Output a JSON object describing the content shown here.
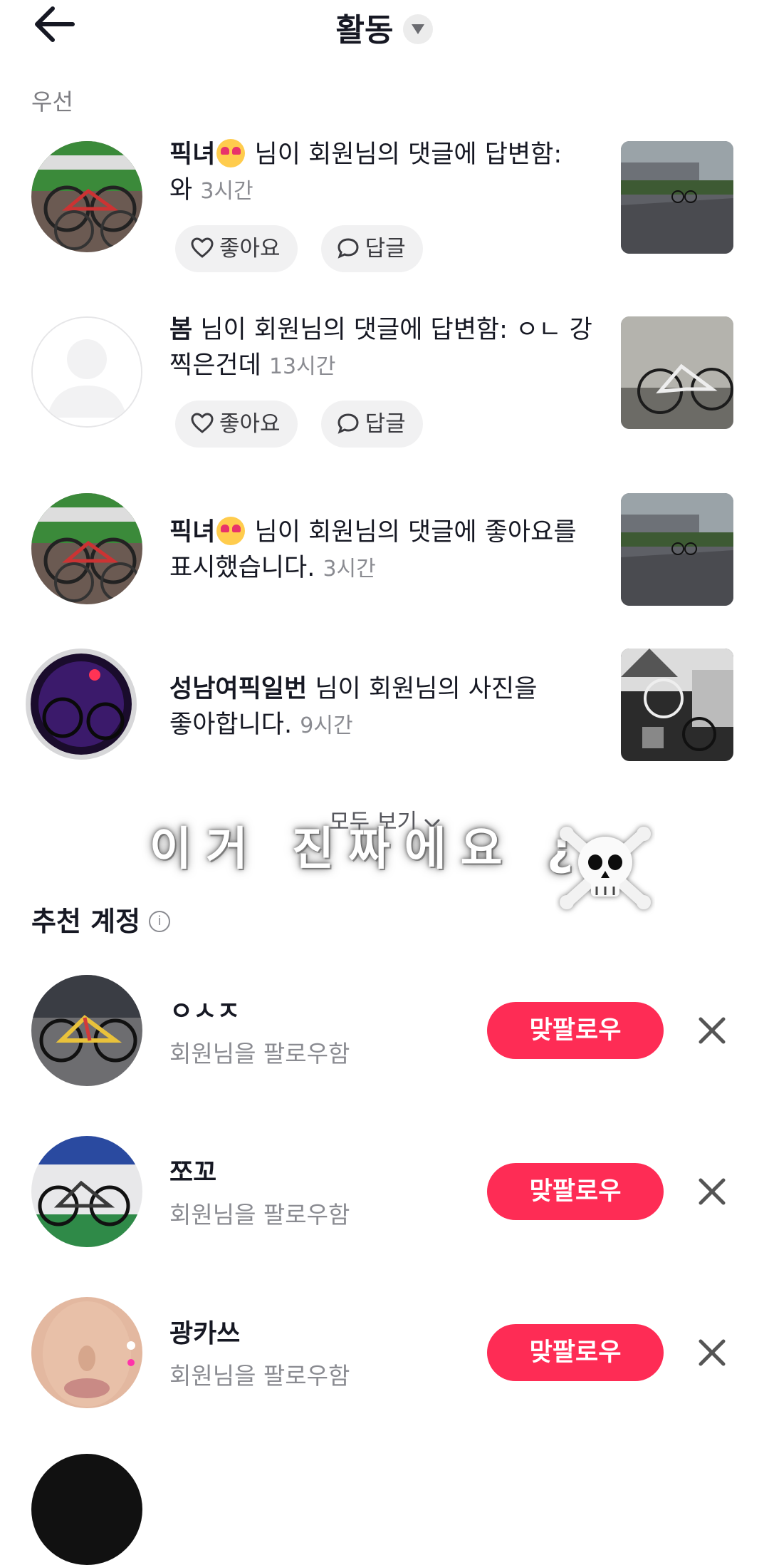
{
  "header": {
    "title": "활동"
  },
  "section_label": "우선",
  "notifications": [
    {
      "user": "픽녀",
      "has_emoji": true,
      "action": "님이 회원님의 댓글에 답변함:",
      "content": "와",
      "time": "3시간",
      "like_label": "좋아요",
      "reply_label": "답글"
    },
    {
      "user": "봄",
      "has_emoji": false,
      "action": "님이 회원님의 댓글에 답변함:",
      "content": "ㅇㄴ 강 찍은건데",
      "time": "13시간",
      "like_label": "좋아요",
      "reply_label": "답글"
    },
    {
      "user": "픽녀",
      "has_emoji": true,
      "action": "님이 회원님의 댓글에 좋아요를",
      "action2": "표시했습니다.",
      "time": "3시간"
    },
    {
      "user": "성남여픽일번",
      "has_emoji": false,
      "action": "님이 회원님의 사진을",
      "action2": "좋아합니다.",
      "time": "9시간"
    }
  ],
  "see_all": "모두 보기",
  "overlay_text": "이거 진짜에요 ¿",
  "recommended": {
    "title": "추천 계정",
    "accounts": [
      {
        "name": "ㅇㅅㅈ",
        "subtitle": "회원님을 팔로우함",
        "button": "맞팔로우"
      },
      {
        "name": "쪼꼬",
        "subtitle": "회원님을 팔로우함",
        "button": "맞팔로우"
      },
      {
        "name": "광카쓰",
        "subtitle": "회원님을 팔로우함",
        "button": "맞팔로우"
      }
    ]
  },
  "colors": {
    "accent": "#fe2c55",
    "text": "#161823",
    "muted": "#8a8b91",
    "pill_bg": "#f1f1f2"
  },
  "icons": [
    "back-arrow-icon",
    "dropdown-caret-icon",
    "heart-icon",
    "comment-bubble-icon",
    "chevron-down-icon",
    "info-icon",
    "close-icon",
    "skull-crossbones-icon"
  ]
}
